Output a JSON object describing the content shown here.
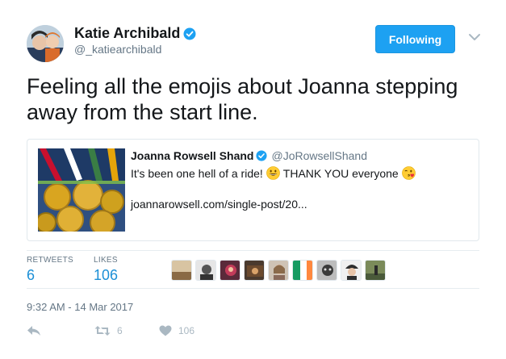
{
  "tweet": {
    "author_name": "Katie Archibald",
    "author_handle": "@_katiearchibald",
    "follow_label": "Following",
    "text": "Feeling all the emojis about Joanna stepping away from the start line.",
    "timestamp": "9:32 AM - 14 Mar 2017"
  },
  "quote": {
    "author_name": "Joanna Rowsell Shand",
    "author_handle": "@JoRowsellShand",
    "text_before": "It's been one hell of a ride!",
    "text_middle": "THANK YOU everyone",
    "link": "joannarowsell.com/single-post/20..."
  },
  "stats": {
    "retweets_label": "RETWEETS",
    "retweets_value": "6",
    "likes_label": "LIKES",
    "likes_value": "106"
  },
  "actions": {
    "retweet_count": "6",
    "like_count": "106"
  },
  "likers": [
    {
      "color": "#c2a27a"
    },
    {
      "color": "#8a8a8a"
    },
    {
      "color": "#c23b5a"
    },
    {
      "color": "#6b4a2e"
    },
    {
      "color": "#7a6a5a"
    },
    {
      "color": "#d97a2b"
    },
    {
      "color": "#3a3a3a"
    },
    {
      "color": "#2e2e2e"
    },
    {
      "color": "#5b6b4a"
    }
  ],
  "colors": {
    "accent": "#1da1f2",
    "muted": "#657786",
    "stat_value": "#1b8fd6"
  }
}
